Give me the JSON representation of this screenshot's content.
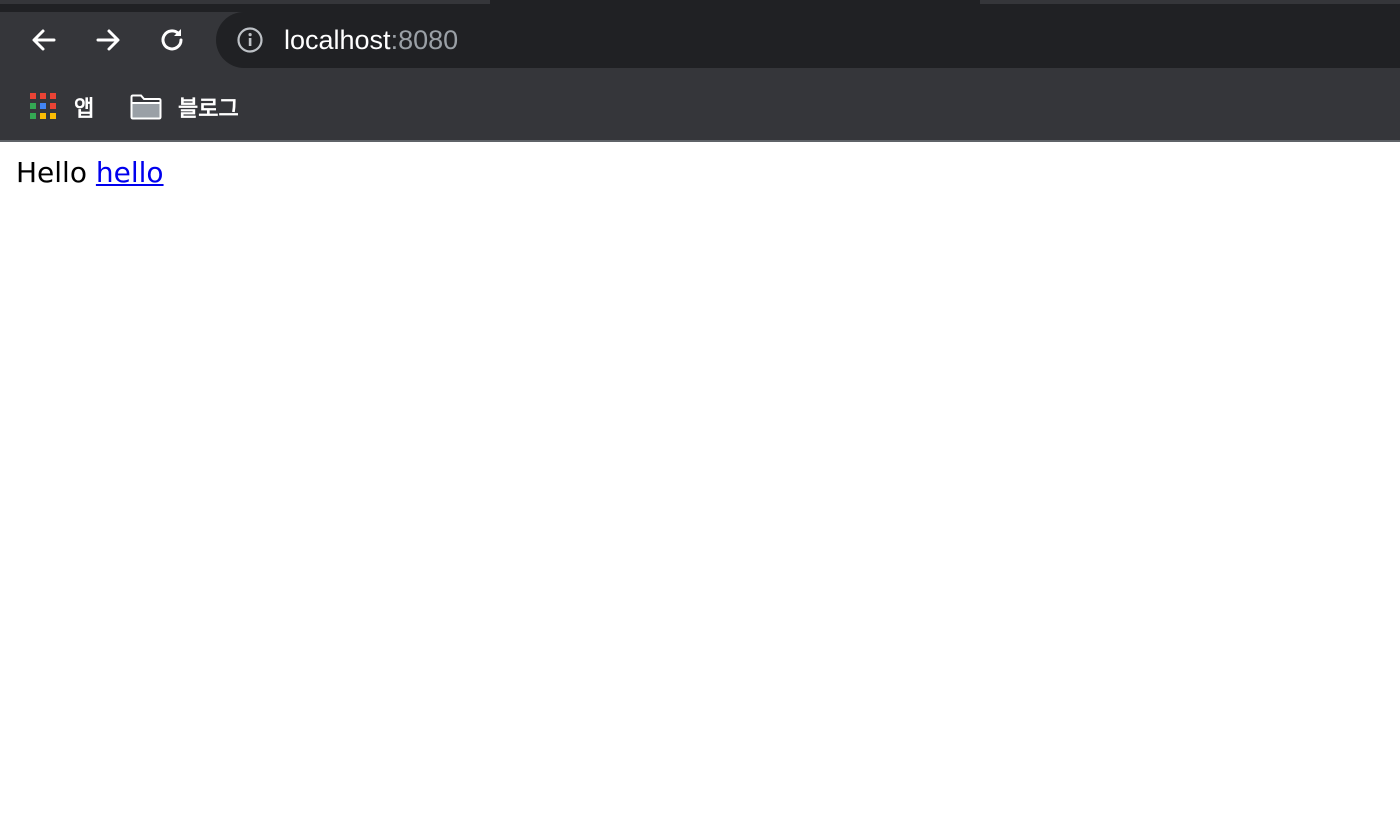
{
  "browser": {
    "url_host": "localhost",
    "url_port": ":8080",
    "bookmarks": [
      {
        "label": "앱",
        "icon": "apps-grid-icon"
      },
      {
        "label": "블로그",
        "icon": "folder-icon"
      }
    ]
  },
  "page": {
    "text": "Hello",
    "link_text": "hello"
  },
  "colors": {
    "chrome_bg": "#35363a",
    "omnibox_bg": "#202124",
    "link": "#0000ee",
    "apps_grid": [
      "#ea4335",
      "#ea4335",
      "#ea4335",
      "#34a853",
      "#4285f4",
      "#ea4335",
      "#34a853",
      "#fbbc04",
      "#fbbc04"
    ]
  }
}
